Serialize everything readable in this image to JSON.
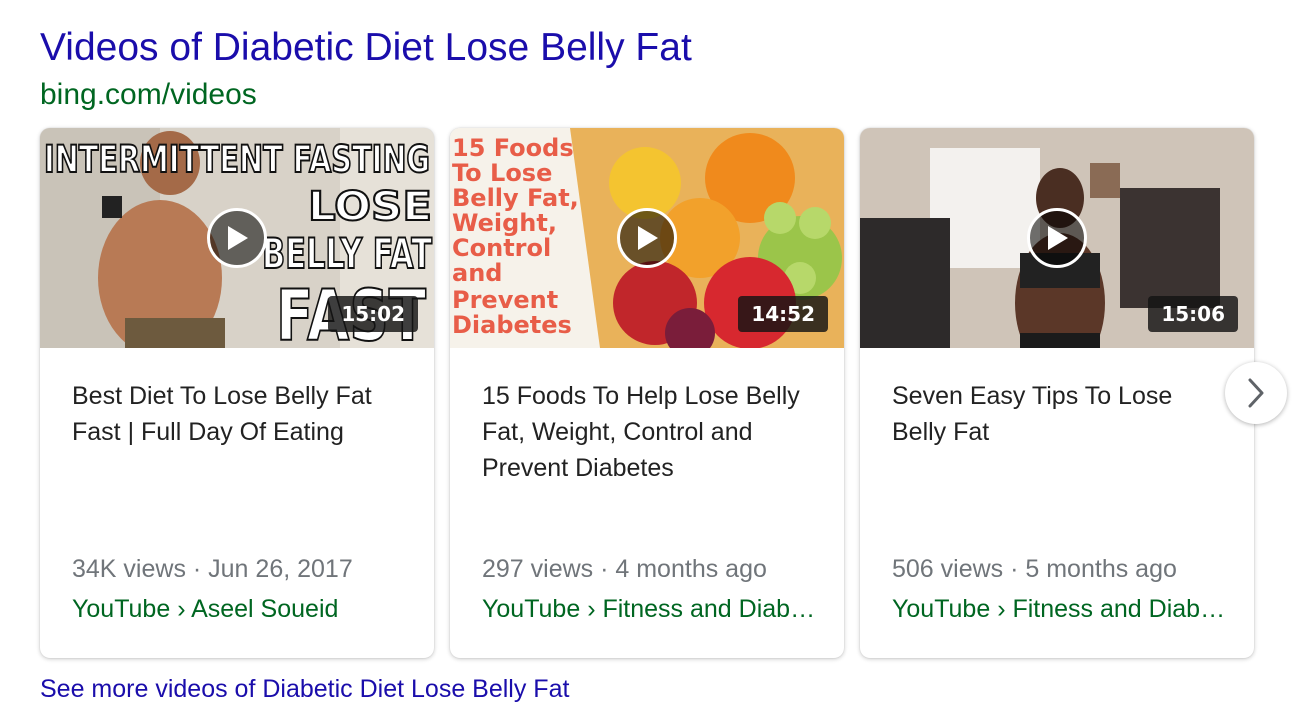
{
  "header": {
    "title": "Videos of Diabetic Diet Lose Belly Fat",
    "source_url": "bing.com/videos"
  },
  "videos": [
    {
      "title": "Best Diet To Lose Belly Fat Fast | Full Day Of Eating",
      "duration": "15:02",
      "meta": "34K views · Jun 26, 2017",
      "channel": "YouTube › Aseel Soueid",
      "thumb_lines": [
        "INTERMITTENT FASTING",
        "LOSE",
        "BELLY FAT",
        "FAST"
      ]
    },
    {
      "title": "15 Foods To Help Lose Belly Fat, Weight, Control and Prevent Diabetes",
      "duration": "14:52",
      "meta": "297 views · 4 months ago",
      "channel": "YouTube › Fitness and Diabetes",
      "thumb_lines": [
        "15 Foods",
        "To Lose",
        "Belly Fat,",
        "Weight,",
        "Control",
        "and",
        "Prevent",
        "Diabetes"
      ]
    },
    {
      "title": "Seven Easy Tips To Lose Belly Fat",
      "duration": "15:06",
      "meta": "506 views · 5 months ago",
      "channel": "YouTube › Fitness and Diabetes"
    }
  ],
  "see_more": "See more videos of Diabetic Diet Lose Belly Fat",
  "icons": {
    "play": "play-icon",
    "next": "chevron-right-icon"
  },
  "colors": {
    "link": "#1a0dab",
    "url_green": "#006621",
    "meta_gray": "#70757a"
  }
}
